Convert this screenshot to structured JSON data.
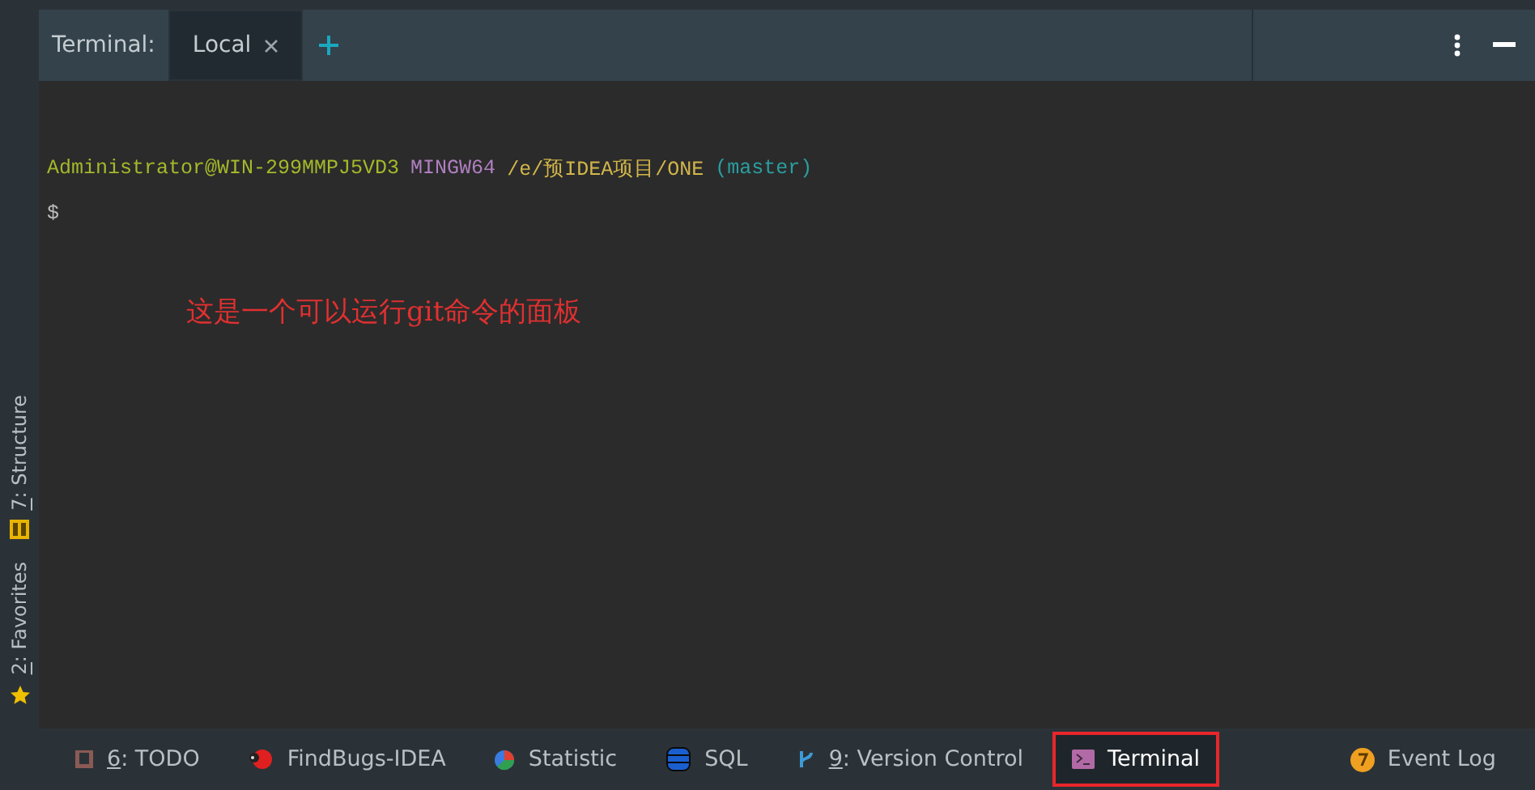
{
  "header": {
    "label": "Terminal:",
    "tabs": [
      {
        "label": "Local",
        "selected": true
      }
    ]
  },
  "terminal": {
    "lines": [
      {
        "segments": [
          {
            "text": "Administrator@WIN-299MMPJ5VD3",
            "color": "#a4b82a"
          },
          {
            "text": "MINGW64",
            "color": "#b07fc0"
          },
          {
            "text": "/e/预IDEA项目/ONE",
            "color": "#d2b64a"
          },
          {
            "text": "(master)",
            "color": "#2b9ea0"
          }
        ]
      },
      {
        "segments": [
          {
            "text": "$",
            "color": "#bbbbbb"
          }
        ]
      }
    ]
  },
  "annotation": "这是一个可以运行git命令的面板",
  "left_tools": [
    {
      "label": "7: Structure",
      "kind": "structure"
    },
    {
      "label": "2: Favorites",
      "kind": "favorites"
    }
  ],
  "bottom_tools": [
    {
      "label": "6: TODO",
      "kind": "todo",
      "selected": false,
      "highlighted": false
    },
    {
      "label": "FindBugs-IDEA",
      "kind": "bug",
      "selected": false,
      "highlighted": false
    },
    {
      "label": "Statistic",
      "kind": "statistic",
      "selected": false,
      "highlighted": false
    },
    {
      "label": "SQL",
      "kind": "database",
      "selected": false,
      "highlighted": false
    },
    {
      "label": "9: Version Control",
      "kind": "branch",
      "selected": false,
      "highlighted": false
    },
    {
      "label": "Terminal",
      "kind": "terminal",
      "selected": true,
      "highlighted": true
    },
    {
      "label": "Event Log",
      "kind": "event",
      "selected": false,
      "highlighted": false
    }
  ]
}
